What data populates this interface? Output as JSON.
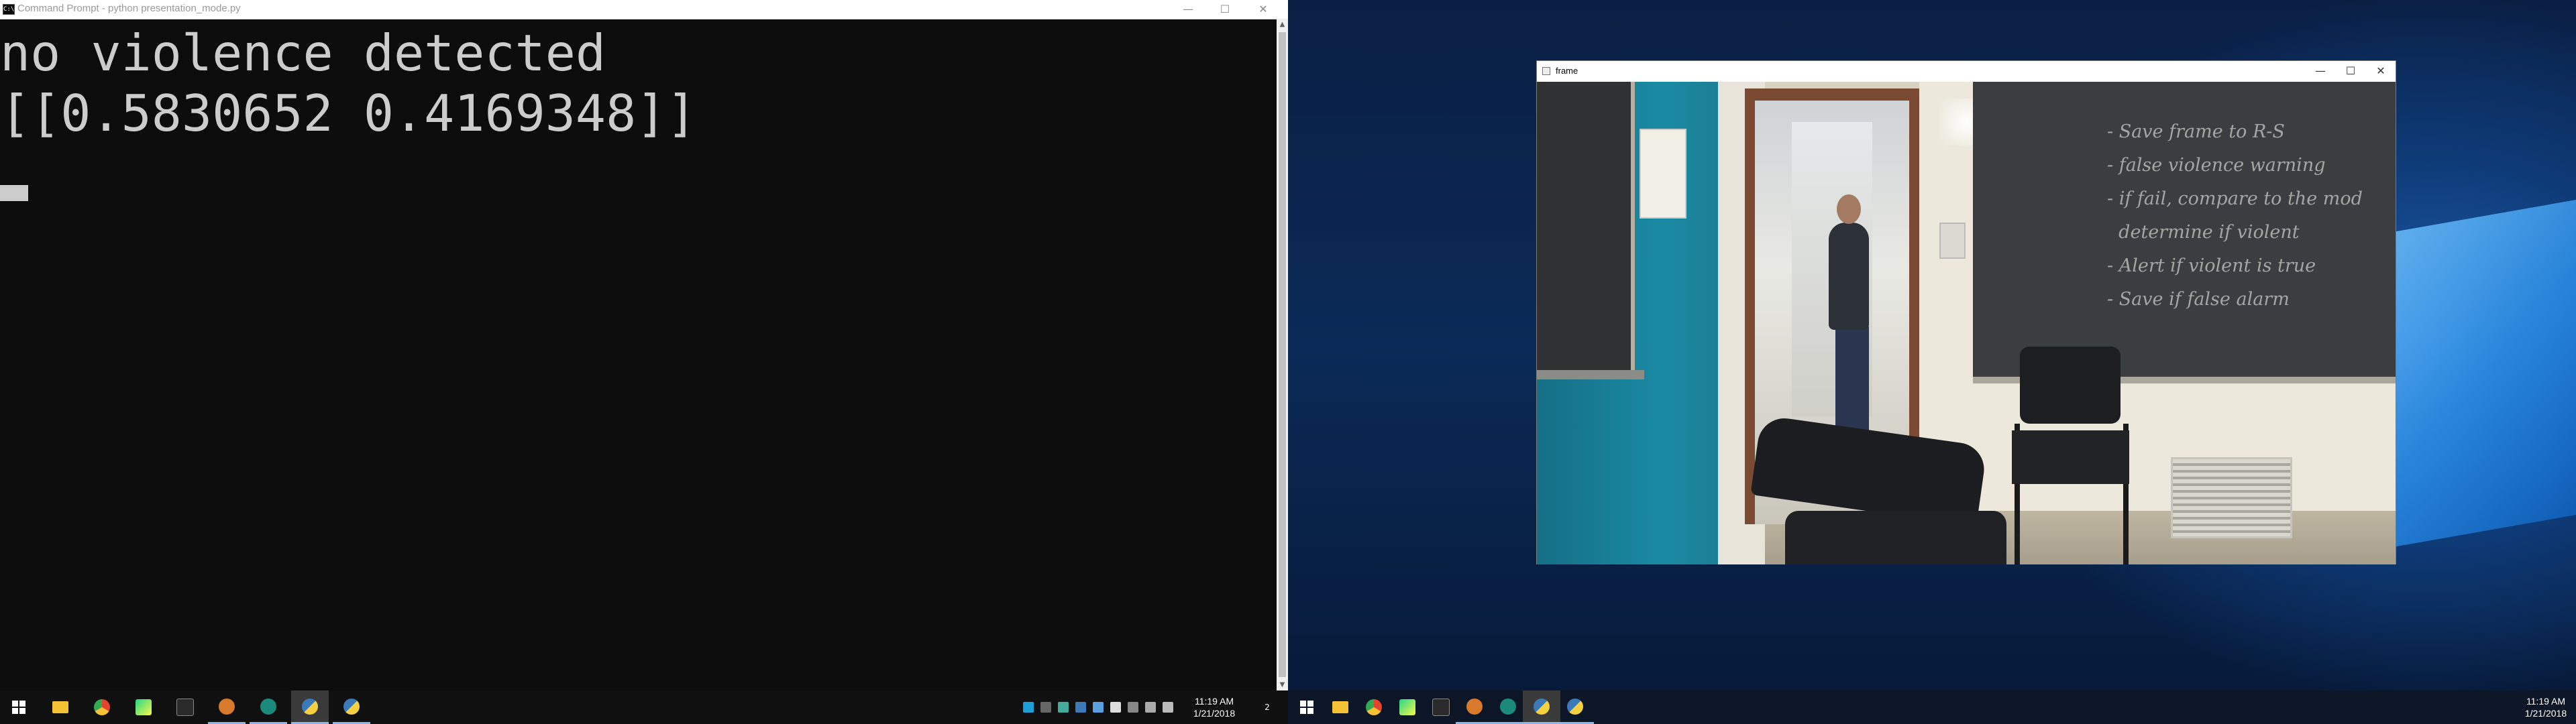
{
  "left_screen": {
    "cmd_window": {
      "title": "Command Prompt - python  presentation_mode.py",
      "output_lines": [
        "no violence detected",
        "[[0.5830652 0.4169348]]"
      ],
      "controls": {
        "minimize": "—",
        "maximize": "☐",
        "close": "✕"
      }
    },
    "taskbar": {
      "items": [
        {
          "name": "start",
          "icon": "windows-logo-icon"
        },
        {
          "name": "file-explorer",
          "icon": "folder-icon",
          "color": "#f5c236"
        },
        {
          "name": "chrome",
          "icon": "chrome-icon",
          "color": "#e3462d"
        },
        {
          "name": "pycharm",
          "icon": "pycharm-icon",
          "color": "#21d789"
        },
        {
          "name": "command-prompt",
          "icon": "terminal-icon",
          "color": "#2a2a2a"
        },
        {
          "name": "app-orange",
          "icon": "orange-app-icon",
          "color": "#d87a2b"
        },
        {
          "name": "app-teal",
          "icon": "teal-circle-icon",
          "color": "#1b8a7a"
        },
        {
          "name": "python-active",
          "icon": "python-icon",
          "color": "#3b79b8"
        },
        {
          "name": "python-running",
          "icon": "python-icon",
          "color": "#3b79b8"
        }
      ],
      "clock": {
        "time": "11:19 AM",
        "date": "1/21/2018"
      },
      "notification_count": "2"
    }
  },
  "right_screen": {
    "frame_window": {
      "title": "frame",
      "controls": {
        "minimize": "—",
        "maximize": "☐",
        "close": "✕"
      },
      "chalkboard_text": "- Save frame to R-S\n- false violence warning\n- if fail, compare to the mod\n  determine if violent\n- Alert if violent is true\n- Save if false alarm"
    },
    "taskbar": {
      "items": [
        {
          "name": "start",
          "icon": "windows-logo-icon"
        },
        {
          "name": "file-explorer",
          "icon": "folder-icon",
          "color": "#f5c236"
        },
        {
          "name": "chrome",
          "icon": "chrome-icon",
          "color": "#e3462d"
        },
        {
          "name": "pycharm",
          "icon": "pycharm-icon",
          "color": "#21d789"
        },
        {
          "name": "command-prompt",
          "icon": "terminal-icon",
          "color": "#2a2a2a"
        },
        {
          "name": "app-orange",
          "icon": "orange-app-icon",
          "color": "#d87a2b"
        },
        {
          "name": "app-teal",
          "icon": "teal-circle-icon",
          "color": "#1b8a7a"
        },
        {
          "name": "python-active",
          "icon": "python-icon",
          "color": "#3b79b8"
        },
        {
          "name": "python-running",
          "icon": "python-icon",
          "color": "#3b79b8"
        }
      ],
      "clock": {
        "time": "11:19 AM",
        "date": "1/21/2018"
      }
    }
  }
}
